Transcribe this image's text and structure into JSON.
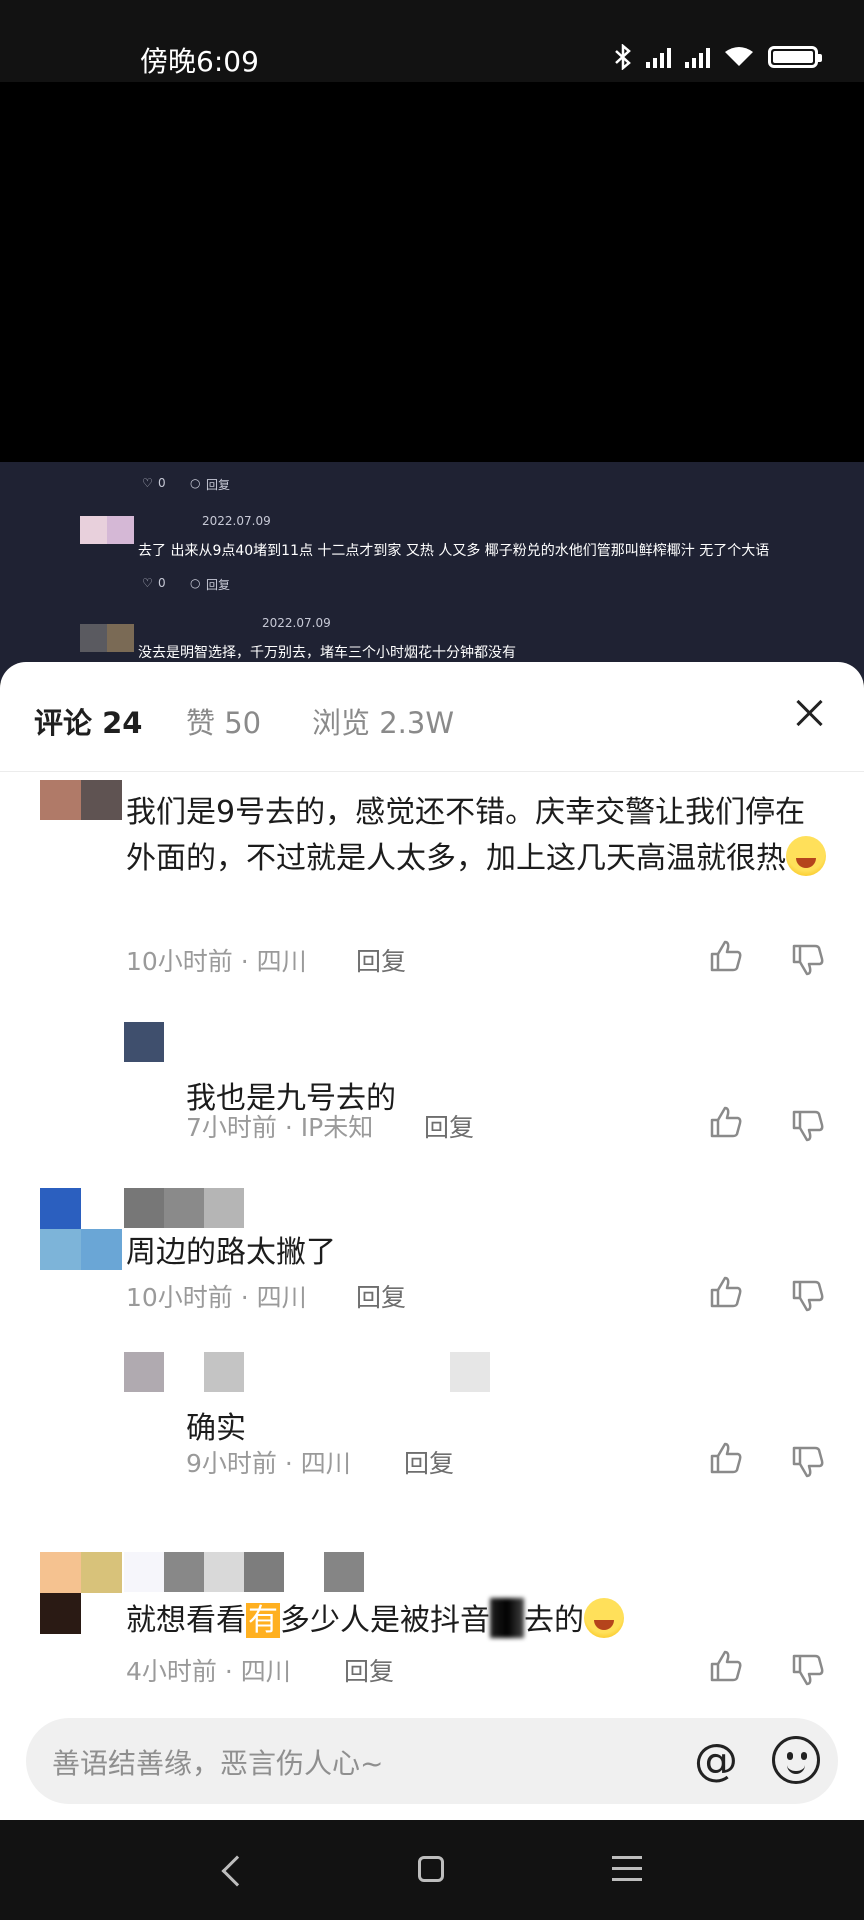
{
  "status_bar": {
    "time": "傍晚6:09",
    "icons": [
      "bluetooth-icon",
      "signal-icon",
      "signal-icon",
      "wifi-icon",
      "battery-icon"
    ]
  },
  "video_overlay": {
    "rows": [
      {
        "likes": "0",
        "reply": "回复"
      },
      {
        "date": "2022.07.09",
        "text": "去了 出来从9点40堵到11点 十二点才到家 又热 人又多 椰子粉兑的水他们管那叫鲜榨椰汁 无了个大语",
        "likes": "0",
        "reply": "回复"
      },
      {
        "date": "2022.07.09",
        "text": "没去是明智选择，千万别去，堵车三个小时烟花十分钟都没有"
      }
    ]
  },
  "panel": {
    "tabs": [
      {
        "label": "评论 24"
      },
      {
        "label": "赞 50"
      },
      {
        "label": "浏览 2.3W"
      }
    ],
    "comments": [
      {
        "text": "我们是9号去的，感觉还不错。庆幸交警让我们停在外面的，不过就是人太多，加上这几天高温就很热",
        "time": "10小时前",
        "location": "四川",
        "reply": "回复"
      },
      {
        "text": "我也是九号去的",
        "time": "7小时前",
        "location": "IP未知",
        "reply": "回复"
      },
      {
        "text": "周边的路太撇了",
        "time": "10小时前",
        "location": "四川",
        "reply": "回复"
      },
      {
        "text": "确实",
        "time": "9小时前",
        "location": "四川",
        "reply": "回复"
      },
      {
        "text_before": "就想看看",
        "highlight": "有",
        "text_middle": "多少人是被抖音",
        "text_after": "去的",
        "time": "4小时前",
        "location": "四川",
        "reply": "回复"
      }
    ],
    "meta_separator": " · "
  },
  "input_bar": {
    "placeholder": "善语结善缘，恶言伤人心~",
    "at_symbol": "@"
  },
  "colors": {
    "highlight": "#ffb020",
    "overlay_bg": "#1f2233",
    "bars": "#121212"
  }
}
